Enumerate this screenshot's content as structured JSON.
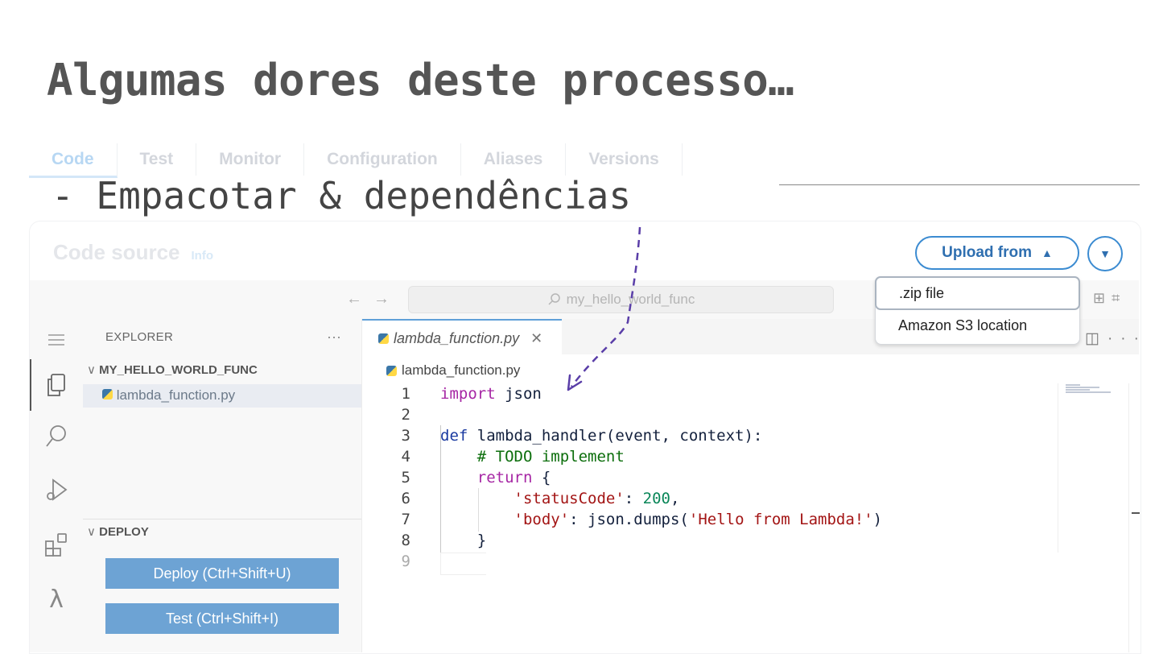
{
  "slide": {
    "title": "Algumas dores deste processo…",
    "bullet": "- Empacotar & dependências"
  },
  "tabs": [
    "Code",
    "Test",
    "Monitor",
    "Configuration",
    "Aliases",
    "Versions"
  ],
  "code_source": {
    "title": "Code source",
    "info": "Info",
    "upload_label": "Upload from",
    "upload_options": [
      ".zip file",
      "Amazon S3 location"
    ]
  },
  "ide": {
    "search": "my_hello_world_func",
    "explorer_title": "EXPLORER",
    "folder": "MY_HELLO_WORLD_FUNC",
    "file": "lambda_function.py",
    "deploy_section": "DEPLOY",
    "deploy_button": "Deploy (Ctrl+Shift+U)",
    "test_button": "Test (Ctrl+Shift+I)",
    "editor_tab": "lambda_function.py",
    "breadcrumb": "lambda_function.py"
  },
  "code_lines": [
    "import json",
    "",
    "def lambda_handler(event, context):",
    "    # TODO implement",
    "    return {",
    "        'statusCode': 200,",
    "        'body': json.dumps('Hello from Lambda!')",
    "    }",
    ""
  ],
  "colors": {
    "accent": "#3b8bd1",
    "button_fill": "#6da3d4",
    "annotation_arrow": "#5a3ea8"
  }
}
